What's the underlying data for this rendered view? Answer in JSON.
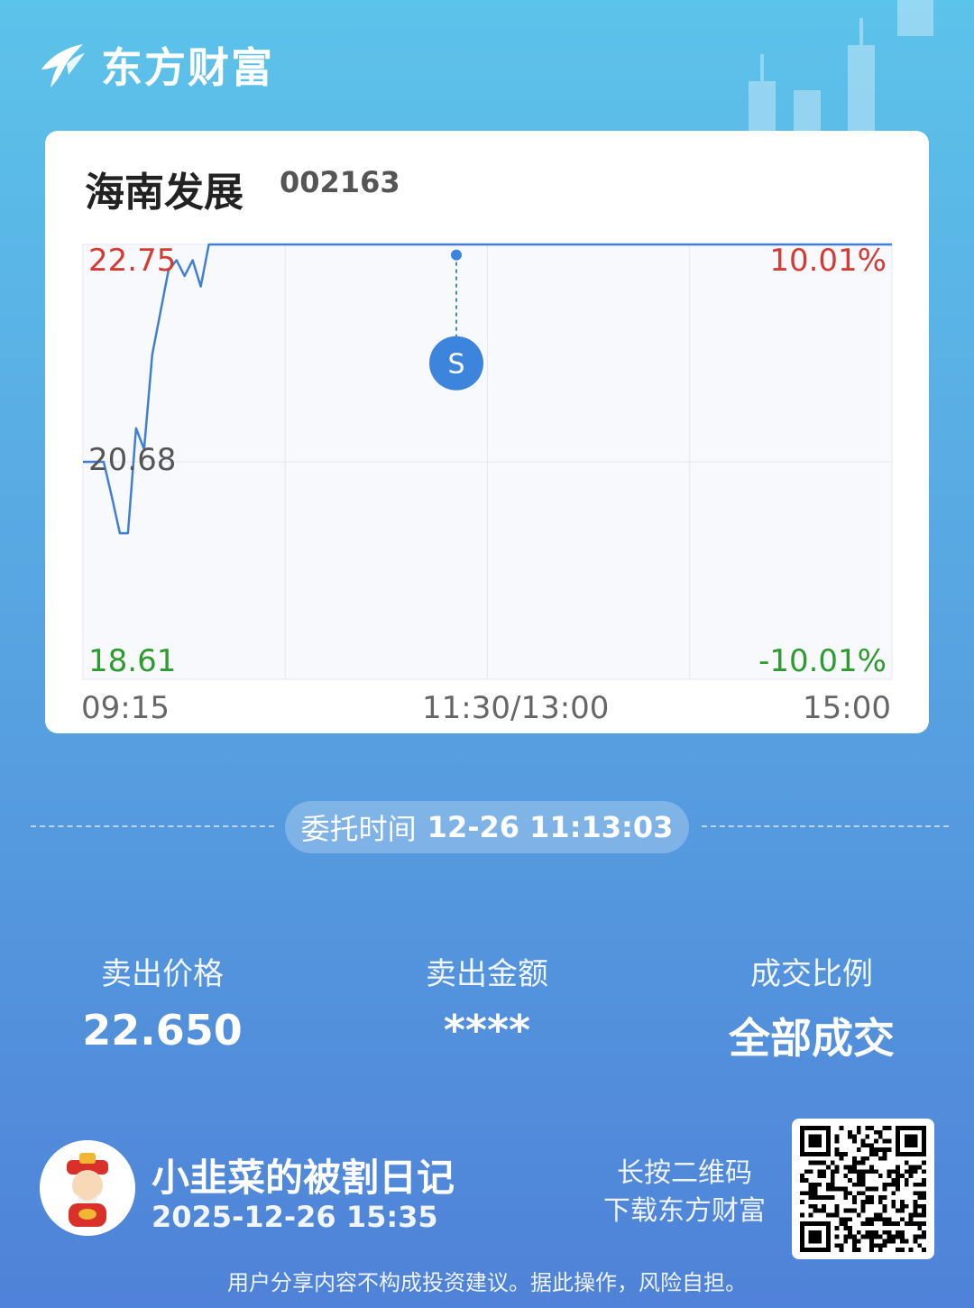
{
  "brand": {
    "name": "东方财富",
    "logo_icon": "eastmoney-logo-icon"
  },
  "stock": {
    "name": "海南发展",
    "code": "002163"
  },
  "chart_data": {
    "type": "line",
    "price_labels": {
      "high": "22.75",
      "mid": "20.68",
      "low": "18.61"
    },
    "pct_labels": {
      "high": "10.01%",
      "low": "-10.01%"
    },
    "time_labels": [
      "09:15",
      "11:30/13:00",
      "15:00"
    ],
    "ylim": [
      18.61,
      22.75
    ],
    "baseline": 20.68,
    "x_minutes_from_open": [
      0,
      5,
      10,
      15,
      20,
      25,
      30,
      35,
      40,
      45,
      50,
      55,
      60,
      65,
      70,
      75,
      80,
      85,
      90,
      95,
      100,
      105,
      110,
      115,
      120,
      240
    ],
    "price": [
      20.68,
      20.68,
      20.35,
      20.0,
      20.0,
      21.0,
      20.8,
      21.7,
      22.1,
      22.5,
      22.6,
      22.45,
      22.6,
      22.35,
      22.75,
      22.75,
      22.75,
      22.75,
      22.75,
      22.75,
      22.75,
      22.75,
      22.75,
      22.75,
      22.75,
      22.75
    ],
    "sell_marker": {
      "label": "S",
      "price": 22.65,
      "time": "11:13"
    }
  },
  "commission": {
    "label": "委托时间",
    "value": "12-26 11:13:03"
  },
  "stats": [
    {
      "label": "卖出价格",
      "value": "22.650"
    },
    {
      "label": "卖出金额",
      "value": "****"
    },
    {
      "label": "成交比例",
      "value": "全部成交"
    }
  ],
  "user": {
    "name": "小韭菜的被割日记",
    "time": "2025-12-26 15:35",
    "avatar_icon": "fortune-god-avatar-icon"
  },
  "qr": {
    "hint_line1": "长按二维码",
    "hint_line2": "下载东方财富",
    "icon": "qr-code-icon"
  },
  "disclaimer": "用户分享内容不构成投资建议。据此操作，风险自担。",
  "colors": {
    "up": "#d53a33",
    "down": "#2d9b2d",
    "line": "#3f7fd6",
    "accent": "#3d84dc"
  }
}
